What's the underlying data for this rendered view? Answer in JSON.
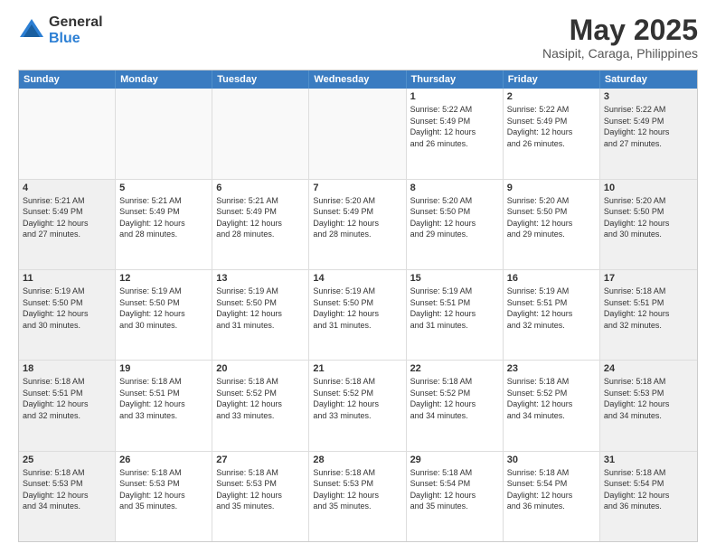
{
  "logo": {
    "general": "General",
    "blue": "Blue"
  },
  "title": "May 2025",
  "subtitle": "Nasipit, Caraga, Philippines",
  "days": [
    "Sunday",
    "Monday",
    "Tuesday",
    "Wednesday",
    "Thursday",
    "Friday",
    "Saturday"
  ],
  "weeks": [
    [
      {
        "day": "",
        "info": ""
      },
      {
        "day": "",
        "info": ""
      },
      {
        "day": "",
        "info": ""
      },
      {
        "day": "",
        "info": ""
      },
      {
        "day": "1",
        "info": "Sunrise: 5:22 AM\nSunset: 5:49 PM\nDaylight: 12 hours\nand 26 minutes."
      },
      {
        "day": "2",
        "info": "Sunrise: 5:22 AM\nSunset: 5:49 PM\nDaylight: 12 hours\nand 26 minutes."
      },
      {
        "day": "3",
        "info": "Sunrise: 5:22 AM\nSunset: 5:49 PM\nDaylight: 12 hours\nand 27 minutes."
      }
    ],
    [
      {
        "day": "4",
        "info": "Sunrise: 5:21 AM\nSunset: 5:49 PM\nDaylight: 12 hours\nand 27 minutes."
      },
      {
        "day": "5",
        "info": "Sunrise: 5:21 AM\nSunset: 5:49 PM\nDaylight: 12 hours\nand 28 minutes."
      },
      {
        "day": "6",
        "info": "Sunrise: 5:21 AM\nSunset: 5:49 PM\nDaylight: 12 hours\nand 28 minutes."
      },
      {
        "day": "7",
        "info": "Sunrise: 5:20 AM\nSunset: 5:49 PM\nDaylight: 12 hours\nand 28 minutes."
      },
      {
        "day": "8",
        "info": "Sunrise: 5:20 AM\nSunset: 5:50 PM\nDaylight: 12 hours\nand 29 minutes."
      },
      {
        "day": "9",
        "info": "Sunrise: 5:20 AM\nSunset: 5:50 PM\nDaylight: 12 hours\nand 29 minutes."
      },
      {
        "day": "10",
        "info": "Sunrise: 5:20 AM\nSunset: 5:50 PM\nDaylight: 12 hours\nand 30 minutes."
      }
    ],
    [
      {
        "day": "11",
        "info": "Sunrise: 5:19 AM\nSunset: 5:50 PM\nDaylight: 12 hours\nand 30 minutes."
      },
      {
        "day": "12",
        "info": "Sunrise: 5:19 AM\nSunset: 5:50 PM\nDaylight: 12 hours\nand 30 minutes."
      },
      {
        "day": "13",
        "info": "Sunrise: 5:19 AM\nSunset: 5:50 PM\nDaylight: 12 hours\nand 31 minutes."
      },
      {
        "day": "14",
        "info": "Sunrise: 5:19 AM\nSunset: 5:50 PM\nDaylight: 12 hours\nand 31 minutes."
      },
      {
        "day": "15",
        "info": "Sunrise: 5:19 AM\nSunset: 5:51 PM\nDaylight: 12 hours\nand 31 minutes."
      },
      {
        "day": "16",
        "info": "Sunrise: 5:19 AM\nSunset: 5:51 PM\nDaylight: 12 hours\nand 32 minutes."
      },
      {
        "day": "17",
        "info": "Sunrise: 5:18 AM\nSunset: 5:51 PM\nDaylight: 12 hours\nand 32 minutes."
      }
    ],
    [
      {
        "day": "18",
        "info": "Sunrise: 5:18 AM\nSunset: 5:51 PM\nDaylight: 12 hours\nand 32 minutes."
      },
      {
        "day": "19",
        "info": "Sunrise: 5:18 AM\nSunset: 5:51 PM\nDaylight: 12 hours\nand 33 minutes."
      },
      {
        "day": "20",
        "info": "Sunrise: 5:18 AM\nSunset: 5:52 PM\nDaylight: 12 hours\nand 33 minutes."
      },
      {
        "day": "21",
        "info": "Sunrise: 5:18 AM\nSunset: 5:52 PM\nDaylight: 12 hours\nand 33 minutes."
      },
      {
        "day": "22",
        "info": "Sunrise: 5:18 AM\nSunset: 5:52 PM\nDaylight: 12 hours\nand 34 minutes."
      },
      {
        "day": "23",
        "info": "Sunrise: 5:18 AM\nSunset: 5:52 PM\nDaylight: 12 hours\nand 34 minutes."
      },
      {
        "day": "24",
        "info": "Sunrise: 5:18 AM\nSunset: 5:53 PM\nDaylight: 12 hours\nand 34 minutes."
      }
    ],
    [
      {
        "day": "25",
        "info": "Sunrise: 5:18 AM\nSunset: 5:53 PM\nDaylight: 12 hours\nand 34 minutes."
      },
      {
        "day": "26",
        "info": "Sunrise: 5:18 AM\nSunset: 5:53 PM\nDaylight: 12 hours\nand 35 minutes."
      },
      {
        "day": "27",
        "info": "Sunrise: 5:18 AM\nSunset: 5:53 PM\nDaylight: 12 hours\nand 35 minutes."
      },
      {
        "day": "28",
        "info": "Sunrise: 5:18 AM\nSunset: 5:53 PM\nDaylight: 12 hours\nand 35 minutes."
      },
      {
        "day": "29",
        "info": "Sunrise: 5:18 AM\nSunset: 5:54 PM\nDaylight: 12 hours\nand 35 minutes."
      },
      {
        "day": "30",
        "info": "Sunrise: 5:18 AM\nSunset: 5:54 PM\nDaylight: 12 hours\nand 36 minutes."
      },
      {
        "day": "31",
        "info": "Sunrise: 5:18 AM\nSunset: 5:54 PM\nDaylight: 12 hours\nand 36 minutes."
      }
    ]
  ]
}
